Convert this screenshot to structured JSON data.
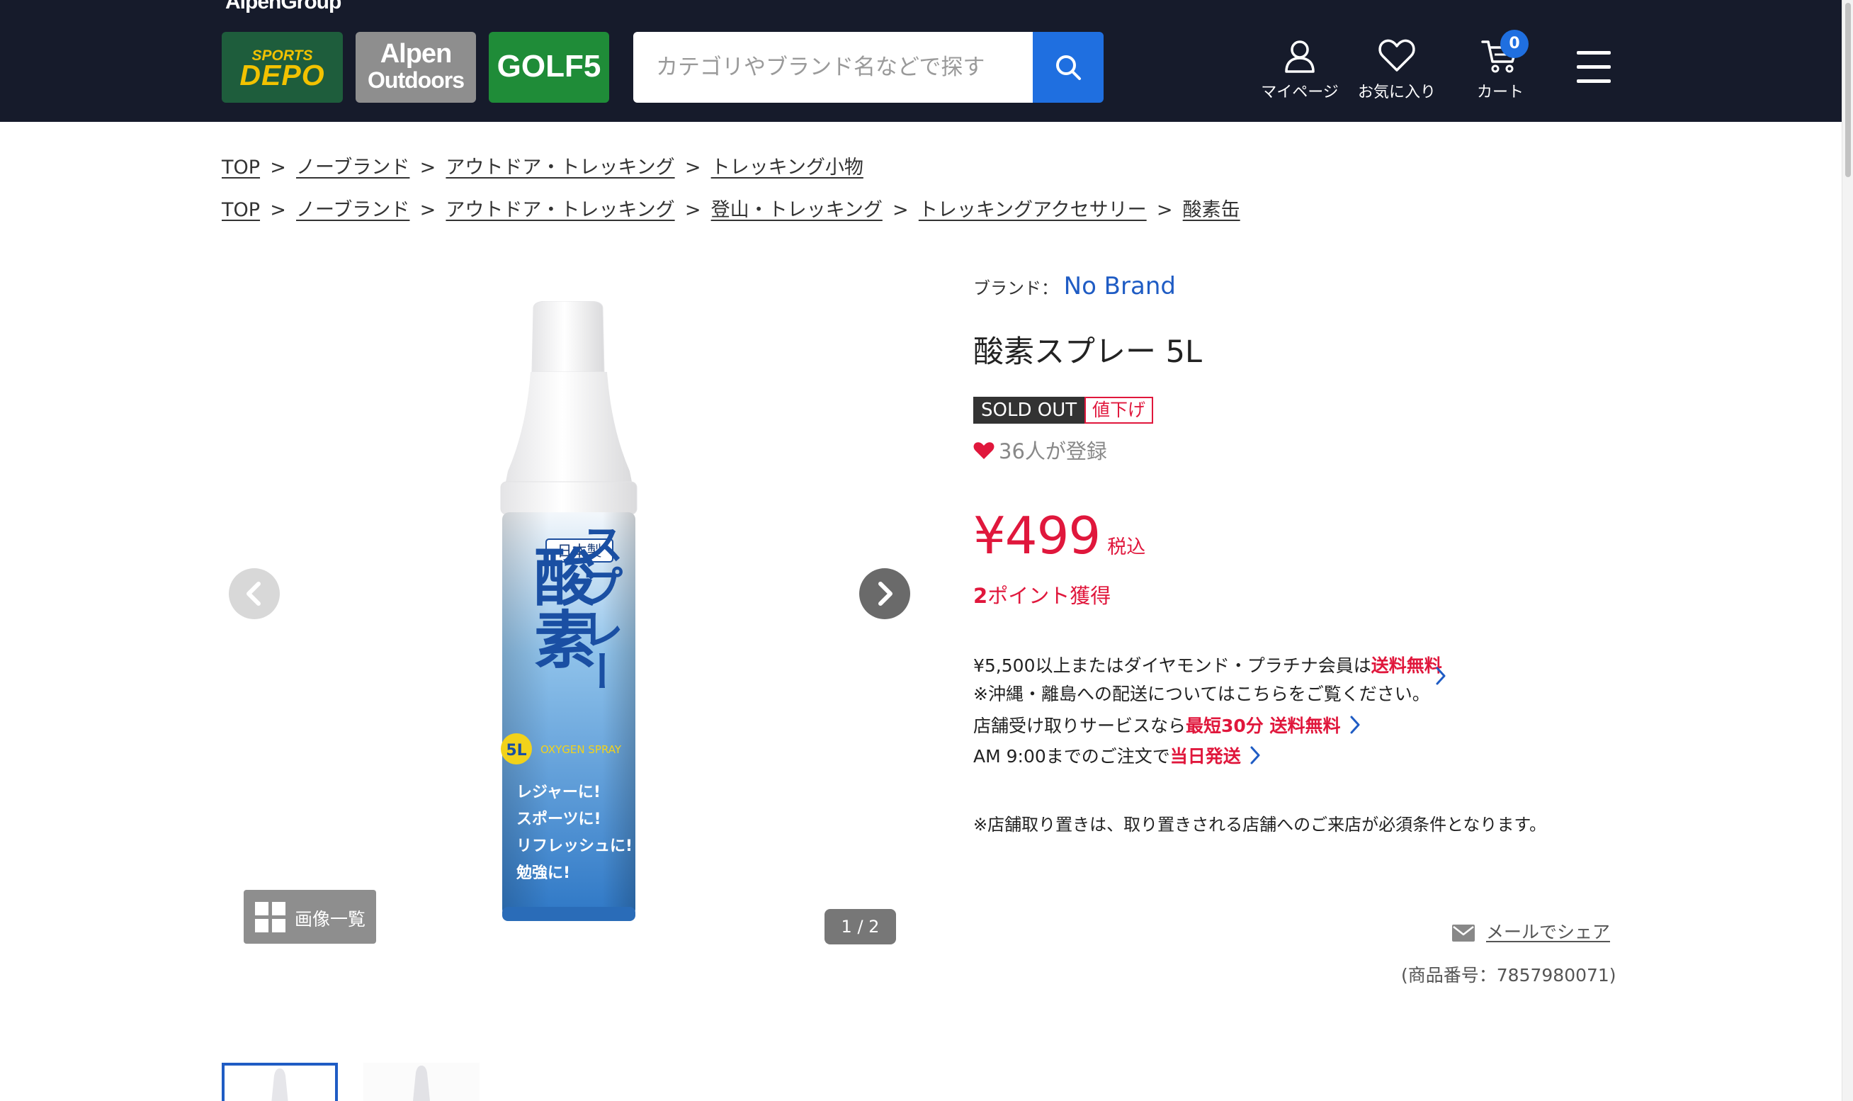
{
  "header": {
    "group_logo": "AlpenGroup",
    "brands": [
      {
        "line1": "SPORTS",
        "line2": "DEPO"
      },
      {
        "line1": "Alpen",
        "line2": "Outdoors"
      },
      {
        "line1": "GOLF5"
      }
    ],
    "search": {
      "placeholder": "カテゴリやブランド名などで探す",
      "value": ""
    },
    "nav": {
      "mypage": "マイページ",
      "favorites": "お気に入り",
      "cart": "カート",
      "cart_count": "0"
    },
    "colors": {
      "bg": "#161b2b",
      "accent": "#1f6fe0"
    }
  },
  "breadcrumbs": [
    [
      "TOP",
      "ノーブランド",
      "アウトドア・トレッキング",
      "トレッキング小物"
    ],
    [
      "TOP",
      "ノーブランド",
      "アウトドア・トレッキング",
      "登山・トレッキング",
      "トレッキングアクセサリー",
      "酸素缶"
    ]
  ],
  "breadcrumb_separator": ">",
  "gallery": {
    "image_list_label": "画像一覧",
    "pager": "1 / 2",
    "can_label": {
      "made_in": "日本製",
      "name_main": "酸素",
      "name_sub": "スプレー",
      "volume": "5L",
      "english": "OXYGEN SPRAY",
      "uses": [
        "レジャーに!",
        "スポーツに!",
        "リフレッシュに!",
        "勉強に!"
      ]
    }
  },
  "product": {
    "brand_label": "ブランド：",
    "brand": "No Brand",
    "title": "酸素スプレー 5L",
    "badges": {
      "soldout": "SOLD OUT",
      "discount": "値下げ"
    },
    "fav_count_text": "36人が登録",
    "price": "¥499",
    "tax_label": "税込",
    "points_value": "2",
    "points_label": "ポイント獲得",
    "shipping": {
      "line1_pre": "¥5,500以上またはダイヤモンド・プラチナ会員は",
      "line1_red": "送料無料",
      "line2": "※沖縄・離島への配送についてはこちらをご覧ください。",
      "line3_pre": "店舗受け取りサービスなら",
      "line3_red": "最短30分 送料無料",
      "line4_pre": "AM 9:00までのご注文で",
      "line4_red": "当日発送"
    },
    "notice": "※店舗取り置きは、取り置きされる店舗へのご来店が必須条件となります。",
    "mail_share": "メールでシェア",
    "code_text": "(商品番号：7857980071)"
  },
  "colors": {
    "price_red": "#e0173c",
    "link_blue": "#1f5cc4"
  }
}
